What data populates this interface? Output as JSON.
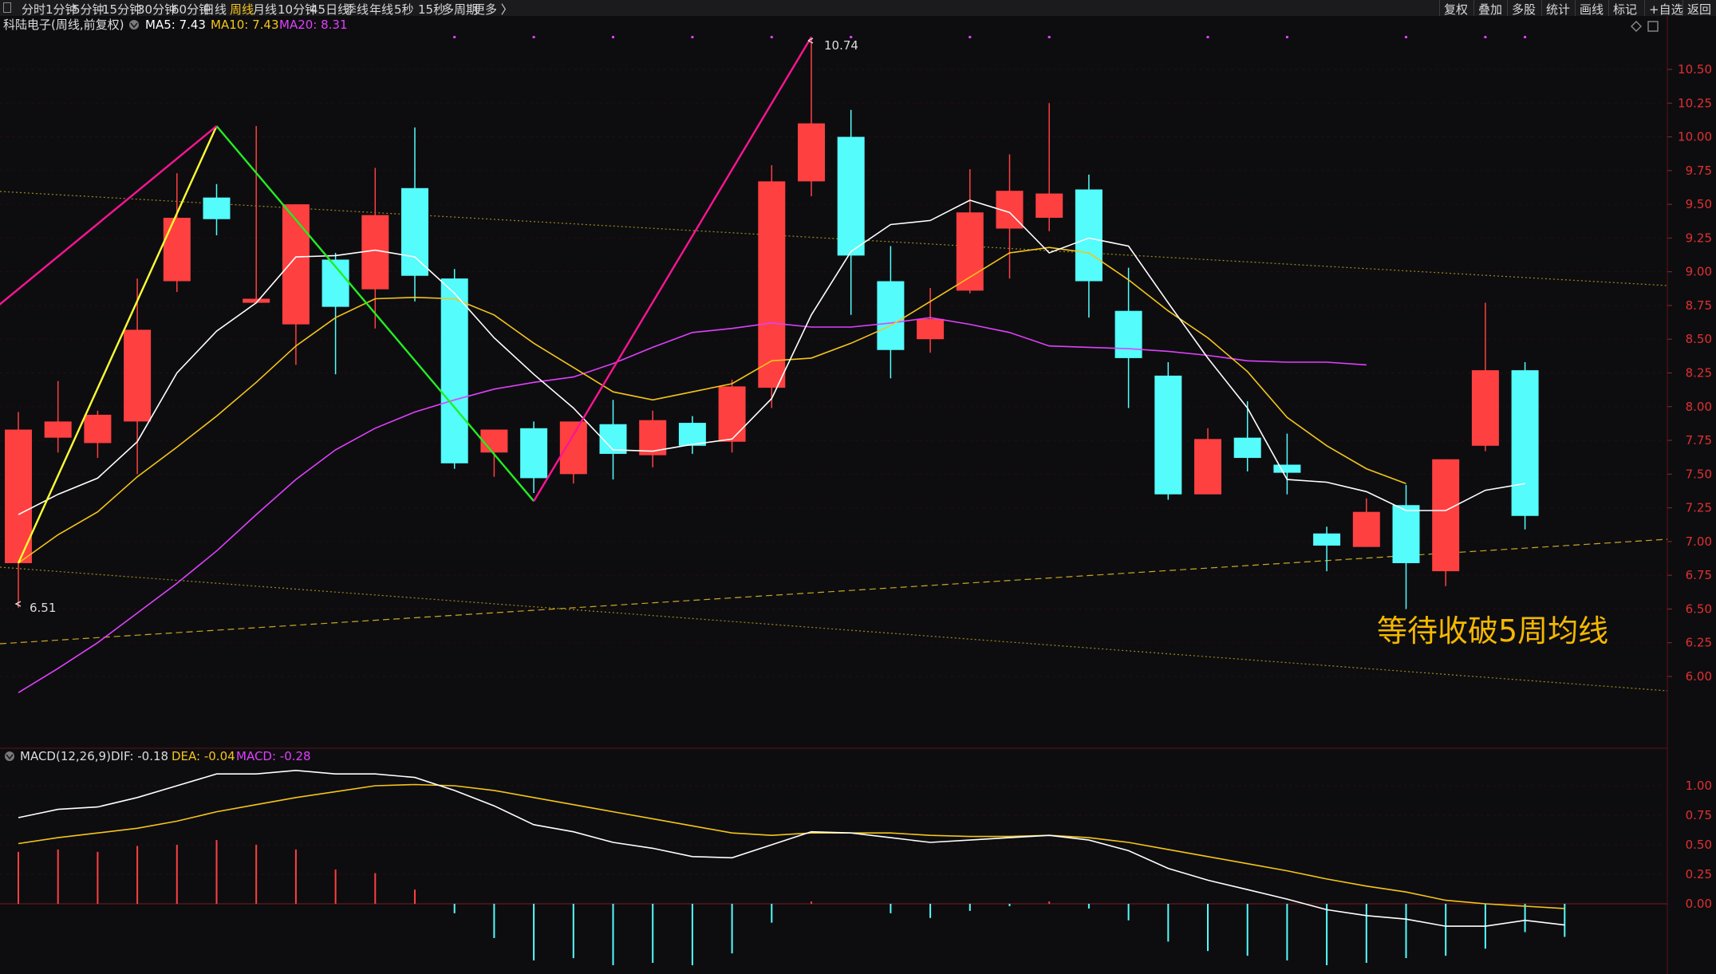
{
  "toolbar": {
    "periods": [
      {
        "label": "分时",
        "active": false
      },
      {
        "label": "1分钟",
        "active": false
      },
      {
        "label": "5分钟",
        "active": false
      },
      {
        "label": "15分钟",
        "active": false
      },
      {
        "label": "30分钟",
        "active": false
      },
      {
        "label": "60分钟",
        "active": false
      },
      {
        "label": "日线",
        "active": false
      },
      {
        "label": "周线",
        "active": true
      },
      {
        "label": "月线",
        "active": false
      },
      {
        "label": "10分钟",
        "active": false
      },
      {
        "label": "45日线",
        "active": false
      },
      {
        "label": "季线",
        "active": false
      },
      {
        "label": "年线",
        "active": false
      },
      {
        "label": "5秒",
        "active": false
      },
      {
        "label": "15秒",
        "active": false
      },
      {
        "label": "多周期",
        "active": false
      },
      {
        "label": "更多 〉",
        "active": false
      }
    ],
    "right_tools": [
      "复权",
      "叠加",
      "多股",
      "统计",
      "画线",
      "标记",
      "+自选",
      "返回"
    ]
  },
  "main_chart": {
    "title": "科陆电子(周线,前复权)",
    "indicators": [
      {
        "label": "MA5: 7.43",
        "color": "#ffffff"
      },
      {
        "label": "MA10: 7.43",
        "color": "#f5c518"
      },
      {
        "label": "MA20: 8.31",
        "color": "#e040fb"
      }
    ],
    "price_high_label": "10.74",
    "price_low_label": "6.51",
    "annotation": "等待收破5周均线",
    "y_ticks": [
      "10.50",
      "10.25",
      "10.00",
      "9.75",
      "9.50",
      "9.25",
      "9.00",
      "8.75",
      "8.50",
      "8.25",
      "8.00",
      "7.75",
      "7.50",
      "7.25",
      "7.00",
      "6.75",
      "6.50",
      "6.25",
      "6.00"
    ]
  },
  "macd_panel": {
    "title": "MACD(12,26,9)",
    "dif_label": "DIF: -0.18",
    "dea_label": "DEA: -0.04",
    "macd_label": "MACD: -0.28",
    "y_ticks": [
      "1.00",
      "0.75",
      "0.50",
      "0.25",
      "0.00"
    ]
  },
  "colors": {
    "up": "#ff4040",
    "down": "#54fcfc",
    "ma5": "#ffffff",
    "ma10": "#f5c518",
    "ma20": "#e040fb",
    "zigzag_magenta": "#ff1493",
    "zigzag_yellow": "#ffff33",
    "zigzag_green": "#22ee22",
    "annotation": "#f5b800"
  },
  "chart_data": {
    "type": "candlestick",
    "ylim": [
      5.8,
      10.7
    ],
    "candles": [
      {
        "o": 6.84,
        "h": 7.96,
        "l": 6.51,
        "c": 7.83
      },
      {
        "o": 7.77,
        "h": 8.19,
        "l": 7.66,
        "c": 7.89
      },
      {
        "o": 7.73,
        "h": 7.97,
        "l": 7.62,
        "c": 7.94
      },
      {
        "o": 7.89,
        "h": 8.95,
        "l": 7.5,
        "c": 8.57
      },
      {
        "o": 8.93,
        "h": 9.73,
        "l": 8.85,
        "c": 9.4
      },
      {
        "o": 9.55,
        "h": 9.65,
        "l": 9.27,
        "c": 9.39
      },
      {
        "o": 8.77,
        "h": 10.08,
        "l": 8.8,
        "c": 8.8
      },
      {
        "o": 8.61,
        "h": 9.5,
        "l": 8.31,
        "c": 9.5
      },
      {
        "o": 9.09,
        "h": 9.14,
        "l": 8.24,
        "c": 8.74
      },
      {
        "o": 8.87,
        "h": 9.77,
        "l": 8.58,
        "c": 9.42
      },
      {
        "o": 9.62,
        "h": 10.07,
        "l": 8.78,
        "c": 8.97
      },
      {
        "o": 8.95,
        "h": 9.02,
        "l": 7.54,
        "c": 7.58
      },
      {
        "o": 7.66,
        "h": 7.82,
        "l": 7.48,
        "c": 7.83
      },
      {
        "o": 7.84,
        "h": 7.89,
        "l": 7.36,
        "c": 7.47
      },
      {
        "o": 7.5,
        "h": 7.87,
        "l": 7.43,
        "c": 7.89
      },
      {
        "o": 7.87,
        "h": 8.05,
        "l": 7.46,
        "c": 7.65
      },
      {
        "o": 7.64,
        "h": 7.97,
        "l": 7.55,
        "c": 7.9
      },
      {
        "o": 7.88,
        "h": 7.93,
        "l": 7.65,
        "c": 7.71
      },
      {
        "o": 7.74,
        "h": 8.2,
        "l": 7.66,
        "c": 8.15
      },
      {
        "o": 8.14,
        "h": 9.79,
        "l": 7.99,
        "c": 9.67
      },
      {
        "o": 9.67,
        "h": 10.74,
        "l": 9.56,
        "c": 10.1
      },
      {
        "o": 10.0,
        "h": 10.2,
        "l": 8.68,
        "c": 9.12
      },
      {
        "o": 8.93,
        "h": 9.19,
        "l": 8.21,
        "c": 8.42
      },
      {
        "o": 8.5,
        "h": 8.88,
        "l": 8.4,
        "c": 8.65
      },
      {
        "o": 8.86,
        "h": 9.76,
        "l": 8.84,
        "c": 9.44
      },
      {
        "o": 9.32,
        "h": 9.87,
        "l": 8.95,
        "c": 9.6
      },
      {
        "o": 9.4,
        "h": 10.25,
        "l": 9.3,
        "c": 9.58
      },
      {
        "o": 9.61,
        "h": 9.72,
        "l": 8.66,
        "c": 8.93
      },
      {
        "o": 8.71,
        "h": 9.03,
        "l": 7.99,
        "c": 8.36
      },
      {
        "o": 8.23,
        "h": 8.33,
        "l": 7.31,
        "c": 7.35
      },
      {
        "o": 7.35,
        "h": 7.84,
        "l": 7.37,
        "c": 7.76
      },
      {
        "o": 7.77,
        "h": 8.04,
        "l": 7.52,
        "c": 7.62
      },
      {
        "o": 7.57,
        "h": 7.8,
        "l": 7.35,
        "c": 7.51
      },
      {
        "o": 7.06,
        "h": 7.11,
        "l": 6.78,
        "c": 6.97
      },
      {
        "o": 6.96,
        "h": 7.32,
        "l": 6.96,
        "c": 7.22
      },
      {
        "o": 7.27,
        "h": 7.42,
        "l": 6.5,
        "c": 6.84
      },
      {
        "o": 6.78,
        "h": 7.61,
        "l": 6.67,
        "c": 7.61
      },
      {
        "o": 7.71,
        "h": 8.77,
        "l": 7.67,
        "c": 8.27
      },
      {
        "o": 8.27,
        "h": 8.33,
        "l": 7.09,
        "c": 7.19
      }
    ],
    "ma5": [
      7.2,
      7.35,
      7.47,
      7.74,
      8.25,
      8.56,
      8.77,
      9.11,
      9.12,
      9.16,
      9.11,
      8.84,
      8.51,
      8.24,
      7.99,
      7.68,
      7.67,
      7.72,
      7.76,
      8.06,
      8.68,
      9.15,
      9.35,
      9.38,
      9.53,
      9.44,
      9.14,
      9.25,
      9.19,
      8.77,
      8.36,
      7.99,
      7.46,
      7.44,
      7.37,
      7.23,
      7.23,
      7.38,
      7.43
    ],
    "ma10": [
      6.84,
      7.05,
      7.22,
      7.48,
      7.7,
      7.93,
      8.18,
      8.45,
      8.66,
      8.8,
      8.81,
      8.8,
      8.68,
      8.47,
      8.29,
      8.11,
      8.05,
      8.11,
      8.17,
      8.34,
      8.36,
      8.47,
      8.6,
      8.78,
      8.96,
      9.14,
      9.18,
      9.14,
      8.94,
      8.71,
      8.51,
      8.26,
      7.92,
      7.71,
      7.54,
      7.43
    ],
    "ma20": [
      5.88,
      6.06,
      6.25,
      6.47,
      6.69,
      6.93,
      7.2,
      7.46,
      7.68,
      7.84,
      7.96,
      8.05,
      8.13,
      8.18,
      8.22,
      8.32,
      8.44,
      8.55,
      8.58,
      8.62,
      8.59,
      8.59,
      8.62,
      8.66,
      8.61,
      8.55,
      8.45,
      8.44,
      8.43,
      8.41,
      8.38,
      8.34,
      8.33,
      8.33,
      8.31
    ],
    "zigzag": [
      {
        "segment": "yellow",
        "points": [
          [
            0,
            6.84
          ],
          [
            5,
            10.08
          ]
        ]
      },
      {
        "segment": "green",
        "points": [
          [
            5,
            10.08
          ],
          [
            13,
            7.3
          ]
        ]
      },
      {
        "segment": "magenta",
        "points": [
          [
            13,
            7.3
          ],
          [
            20,
            10.74
          ]
        ]
      },
      {
        "segment": "magenta",
        "points": [
          [
            -0.5,
            8.75
          ],
          [
            5,
            10.08
          ]
        ]
      }
    ],
    "macd": {
      "ylim": [
        -1.25,
        1.25
      ],
      "dif": [
        0.73,
        0.8,
        0.82,
        0.9,
        1.0,
        1.1,
        1.1,
        1.13,
        1.1,
        1.1,
        1.07,
        0.96,
        0.83,
        0.67,
        0.61,
        0.52,
        0.47,
        0.4,
        0.39,
        0.5,
        0.61,
        0.6,
        0.56,
        0.52,
        0.54,
        0.56,
        0.58,
        0.54,
        0.45,
        0.3,
        0.2,
        0.12,
        0.04,
        -0.05,
        -0.1,
        -0.13,
        -0.19,
        -0.19,
        -0.14,
        -0.18
      ],
      "dea": [
        0.51,
        0.56,
        0.6,
        0.64,
        0.7,
        0.78,
        0.84,
        0.9,
        0.95,
        1.0,
        1.01,
        1.0,
        0.96,
        0.9,
        0.84,
        0.78,
        0.72,
        0.66,
        0.6,
        0.58,
        0.6,
        0.6,
        0.6,
        0.58,
        0.57,
        0.57,
        0.58,
        0.56,
        0.52,
        0.46,
        0.4,
        0.34,
        0.28,
        0.21,
        0.15,
        0.1,
        0.03,
        0.0,
        -0.02,
        -0.04
      ],
      "hist": [
        0.44,
        0.46,
        0.44,
        0.49,
        0.5,
        0.54,
        0.5,
        0.46,
        0.29,
        0.26,
        0.12,
        -0.08,
        -0.29,
        -0.48,
        -0.46,
        -0.52,
        -0.5,
        -0.52,
        -0.42,
        -0.16,
        0.02,
        0.0,
        -0.08,
        -0.12,
        -0.06,
        -0.02,
        0.02,
        -0.04,
        -0.14,
        -0.32,
        -0.4,
        -0.44,
        -0.48,
        -0.52,
        -0.5,
        -0.46,
        -0.44,
        -0.38,
        -0.24,
        -0.28
      ]
    }
  }
}
